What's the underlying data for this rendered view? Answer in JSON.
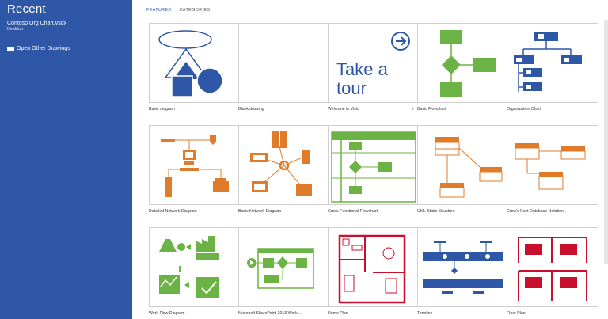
{
  "sidebar": {
    "title": "Recent",
    "recent": {
      "name": "Contoso Org Chart.vsdx",
      "location": "Desktop"
    },
    "open_other": "Open Other Drawings"
  },
  "tabs": {
    "featured": "FEATURED",
    "categories": "CATEGORIES"
  },
  "templates": [
    "Basic diagram",
    "Blank drawing",
    "Welcome to Visio",
    "Basic Flowchart",
    "Organization Chart",
    "Detailed Network Diagram",
    "Basic Network Diagram",
    "Cross-Functional Flowchart",
    "UML Static Structure",
    "Crow's Foot Database Notation",
    "Work Flow Diagram",
    "Microsoft SharePoint 2013 Work...",
    "Home Plan",
    "Timeline",
    "Floor Plan"
  ],
  "tour_text": {
    "line1": "Take a",
    "line2": "tour"
  },
  "colors": {
    "sidebar": "#2e57a8",
    "blue": "#2e57a8",
    "green": "#6bb344",
    "orange": "#e07b2a",
    "red": "#c8102e"
  }
}
